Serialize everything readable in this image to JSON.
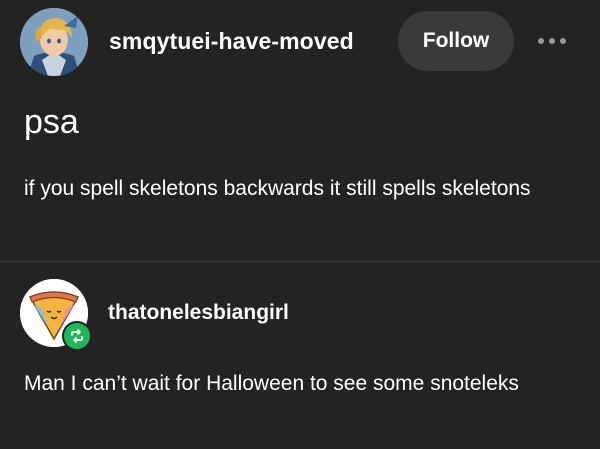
{
  "post": {
    "author": {
      "username": "smqytuei-have-moved",
      "avatar_icon": "character-avatar-icon"
    },
    "follow_label": "Follow",
    "more_icon": "more-options-icon",
    "title": "psa",
    "body": "if you spell skeletons backwards it still spells skeletons"
  },
  "reblog": {
    "author": {
      "username": "thatonelesbiangirl",
      "avatar_icon": "pizza-slice-avatar-icon",
      "badge_icon": "reblog-icon"
    },
    "body": "Man I can’t wait for Halloween to see some snoteleks"
  },
  "colors": {
    "background": "#232323",
    "follow_button": "#3a3a3a",
    "reblog_badge": "#1fb55a",
    "text": "#ffffff"
  }
}
